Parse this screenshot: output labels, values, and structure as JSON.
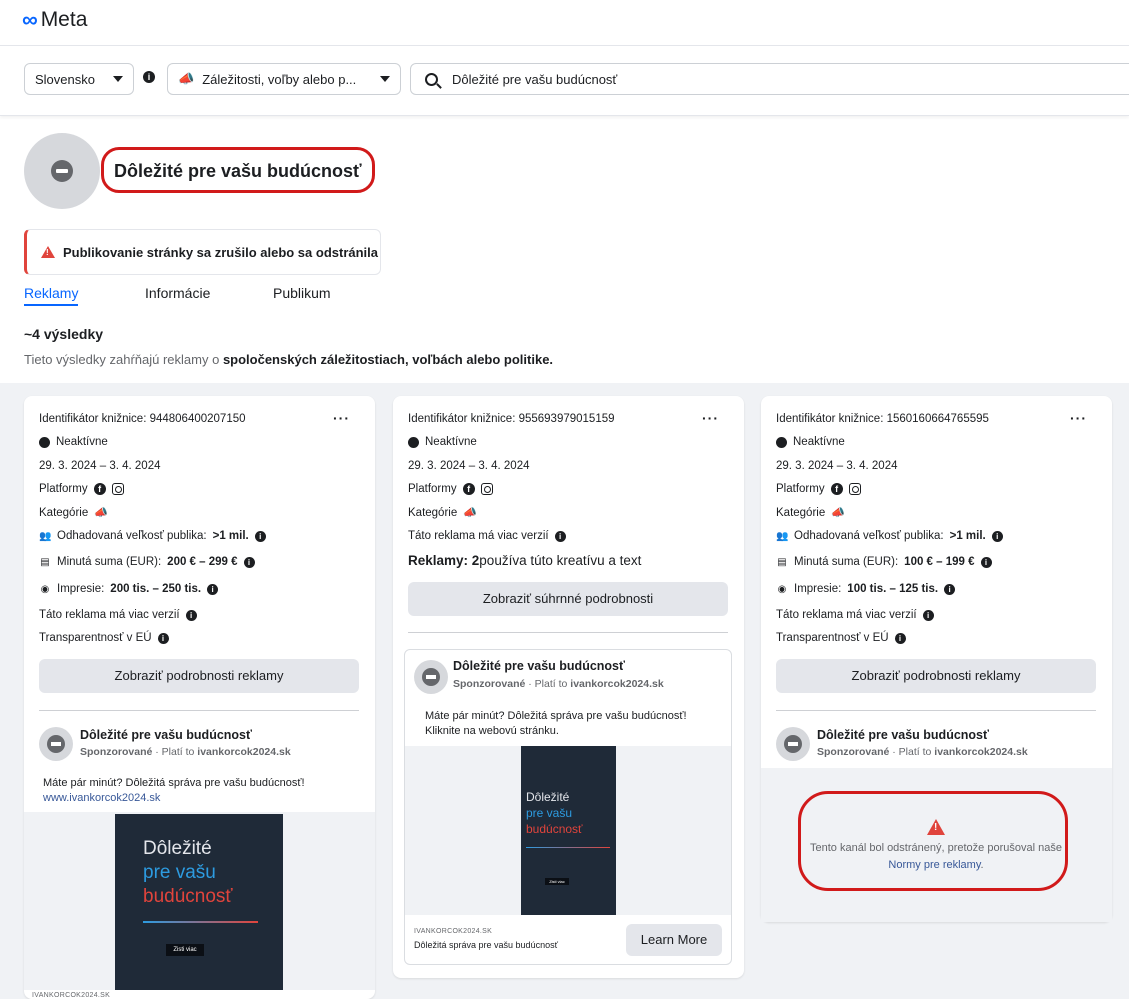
{
  "brand": {
    "logo_symbol": "∞",
    "logo_text": "Meta",
    "accent": "#0866ff"
  },
  "filters": {
    "country": "Slovensko",
    "ad_type": "Záležitosti, voľby alebo p...",
    "search_value": "Dôležité pre vašu budúcnosť"
  },
  "page": {
    "title": "Dôležité pre vašu budúcnosť",
    "alert": "Publikovanie stránky sa zrušilo alebo sa odstránila"
  },
  "tabs": [
    {
      "label": "Reklamy",
      "active": true
    },
    {
      "label": "Informácie",
      "active": false
    },
    {
      "label": "Publikum",
      "active": false
    }
  ],
  "results": {
    "count": "~4 výsledky",
    "note_prefix": "Tieto výsledky zahŕňajú reklamy o ",
    "note_bold": "spoločenských záležitostiach, voľbách alebo politike."
  },
  "cards": [
    {
      "library_id": "Identifikátor knižnice: 944806400207150",
      "status": "Neaktívne",
      "dates": "29. 3. 2024 – 3. 4. 2024",
      "platforms_label": "Platformy",
      "category_label": "Kategórie",
      "audience_label": "Odhadovaná veľkosť publika: ",
      "audience_value": ">1 mil.",
      "spend_label": "Minutá suma (EUR): ",
      "spend_value": "200 € – 299 €",
      "impressions_label": "Impresie: ",
      "impressions_value": "200 tis. – 250 tis.",
      "versions": "Táto reklama má viac verzií",
      "transparency": "Transparentnosť v EÚ",
      "button": "Zobraziť podrobnosti reklamy",
      "ad_name": "Dôležité pre vašu budúcnosť",
      "ad_sponsored": "Sponzorované",
      "ad_paid": " · Platí to ",
      "ad_payer": "ivankorcok2024.sk",
      "ad_text": "Máte pár minút? Dôležitá správa pre vašu budúcnosť!",
      "ad_link": "www.ivankorcok2024.sk",
      "creative_l1": "Dôležité",
      "creative_l2": "pre vašu",
      "creative_l3": "budúcnosť",
      "creative_btn": "Zisti viac",
      "footer_domain": "IVANKORCOK2024.SK"
    },
    {
      "library_id": "Identifikátor knižnice: 955693979015159",
      "status": "Neaktívne",
      "dates": "29. 3. 2024 – 3. 4. 2024",
      "platforms_label": "Platformy",
      "category_label": "Kategórie",
      "versions": "Táto reklama má viac verzií",
      "ads_count_bold": "Reklamy: 2",
      "ads_count_rest": " používa túto kreatívu a text",
      "button": "Zobraziť súhrnné podrobnosti",
      "ad_name": "Dôležité pre vašu budúcnosť",
      "ad_sponsored": "Sponzorované",
      "ad_paid": " · Platí to ",
      "ad_payer": "ivankorcok2024.sk",
      "ad_text_1": "Máte pár minút? Dôležitá správa pre vašu budúcnosť!",
      "ad_text_2": "Kliknite na webovú stránku.",
      "creative_l1": "Dôležité",
      "creative_l2": "pre vašu",
      "creative_l3": "budúcnosť",
      "creative_btn": "Zisti viac",
      "footer_domain": "IVANKORCOK2024.SK",
      "footer_title": "Dôležitá správa pre vašu budúcnosť",
      "cta": "Learn More"
    },
    {
      "library_id": "Identifikátor knižnice: 1560160664765595",
      "status": "Neaktívne",
      "dates": "29. 3. 2024 – 3. 4. 2024",
      "platforms_label": "Platformy",
      "category_label": "Kategórie",
      "audience_label": "Odhadovaná veľkosť publika: ",
      "audience_value": ">1 mil.",
      "spend_label": "Minutá suma (EUR): ",
      "spend_value": "100 € – 199 €",
      "impressions_label": "Impresie: ",
      "impressions_value": "100 tis. – 125 tis.",
      "versions": "Táto reklama má viac verzií",
      "transparency": "Transparentnosť v EÚ",
      "button": "Zobraziť podrobnosti reklamy",
      "ad_name": "Dôležité pre vašu budúcnosť",
      "ad_sponsored": "Sponzorované",
      "ad_paid": " · Platí to ",
      "ad_payer": "ivankorcok2024.sk",
      "removed_text": "Tento kanál bol odstránený, pretože porušoval naše ",
      "removed_link": "Normy pre reklamy",
      "removed_end": "."
    }
  ]
}
